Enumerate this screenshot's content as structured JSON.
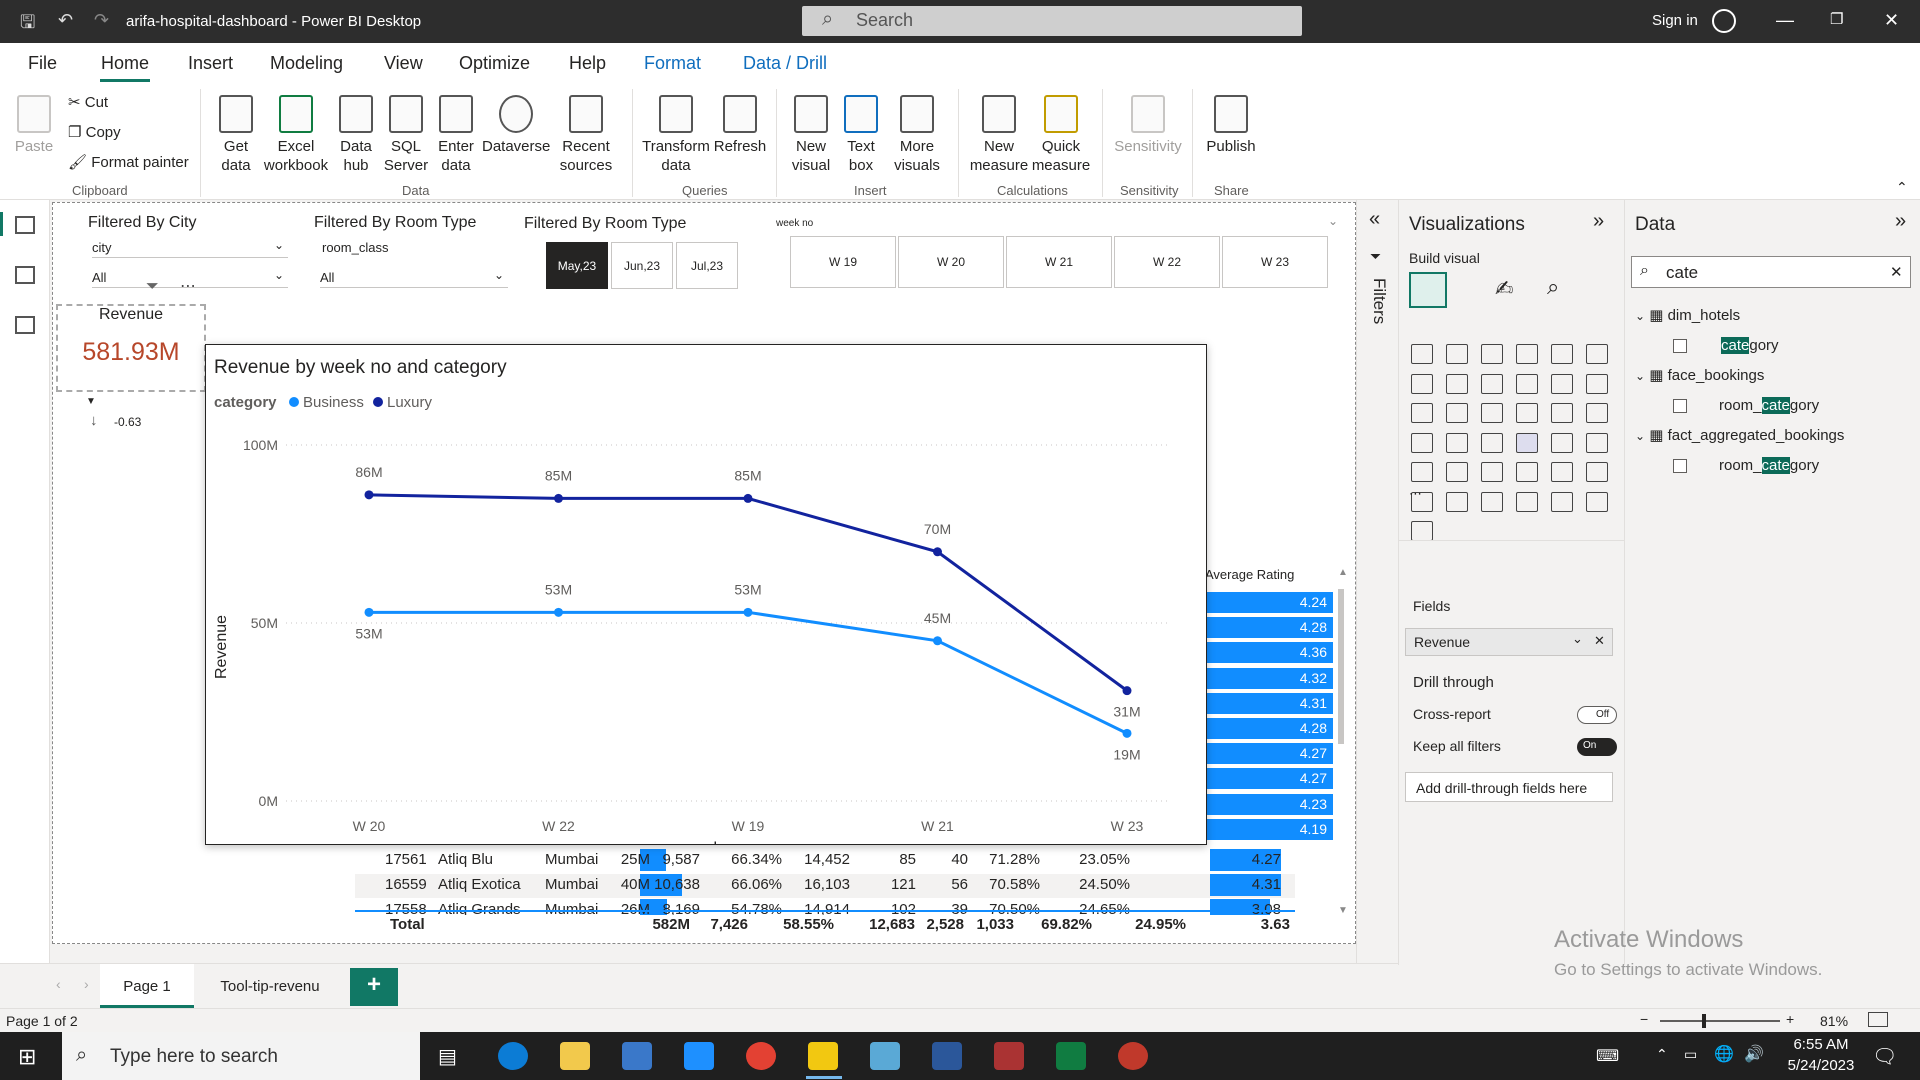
{
  "window": {
    "title": "arifa-hospital-dashboard - Power BI Desktop",
    "search_placeholder": "Search",
    "sign_in": "Sign in"
  },
  "tabs": [
    "File",
    "Home",
    "Insert",
    "Modeling",
    "View",
    "Optimize",
    "Help",
    "Format",
    "Data / Drill"
  ],
  "ribbon": {
    "clipboard": {
      "paste": "Paste",
      "cut": "Cut",
      "copy": "Copy",
      "format_painter": "Format painter",
      "label": "Clipboard"
    },
    "data": {
      "get_data": "Get data",
      "excel": "Excel workbook",
      "data_hub": "Data hub",
      "sql": "SQL Server",
      "enter": "Enter data",
      "dataverse": "Dataverse",
      "recent": "Recent sources",
      "label": "Data"
    },
    "queries": {
      "transform": "Transform data",
      "refresh": "Refresh",
      "label": "Queries"
    },
    "insert": {
      "new_visual": "New visual",
      "text_box": "Text box",
      "more_visuals": "More visuals",
      "label": "Insert"
    },
    "calculations": {
      "new_measure": "New measure",
      "quick_measure": "Quick measure",
      "label": "Calculations"
    },
    "sensitivity": {
      "btn": "Sensitivity",
      "label": "Sensitivity"
    },
    "share": {
      "publish": "Publish",
      "label": "Share"
    }
  },
  "slicers": {
    "city": {
      "title": "Filtered By City",
      "field": "city",
      "value": "All"
    },
    "room_type": {
      "title": "Filtered By Room Type",
      "field": "room_class",
      "value": "All"
    },
    "month": {
      "title": "Filtered By Room Type",
      "tiles": [
        "May,23",
        "Jun,23",
        "Jul,23"
      ],
      "selected": "May,23"
    },
    "week": {
      "field": "week no",
      "tiles": [
        "W 19",
        "W 20",
        "W 21",
        "W 22",
        "W 23"
      ]
    }
  },
  "card": {
    "label": "Revenue",
    "value": "581.93M",
    "delta": "-0.63"
  },
  "chart_data": {
    "type": "line",
    "title": "Revenue by week no and category",
    "legend_title": "category",
    "xlabel": "week no",
    "ylabel": "Revenue",
    "categories": [
      "W 20",
      "W 22",
      "W 19",
      "W 21",
      "W 23"
    ],
    "y_ticks": [
      "100M",
      "50M",
      "0M"
    ],
    "ylim": [
      0,
      100
    ],
    "series": [
      {
        "name": "Business",
        "color": "#118dff",
        "values": [
          53,
          53,
          53,
          45,
          19
        ],
        "labels": [
          "53M",
          "53M",
          "53M",
          "45M",
          "19M"
        ]
      },
      {
        "name": "Luxury",
        "color": "#12239e",
        "values": [
          86,
          85,
          85,
          70,
          31
        ],
        "labels": [
          "86M",
          "85M",
          "85M",
          "70M",
          "31M"
        ]
      }
    ]
  },
  "table": {
    "header_avg_rating": "Average Rating",
    "rating_bars": [
      "4.24",
      "4.28",
      "4.36",
      "4.32",
      "4.31",
      "4.28",
      "4.27",
      "4.27",
      "4.23",
      "4.19"
    ],
    "rows": [
      [
        "17561",
        "Atliq Blu",
        "Mumbai",
        "25M",
        "9,587",
        "66.34%",
        "14,452",
        "85",
        "40",
        "71.28%",
        "23.05%",
        "4.27"
      ],
      [
        "16559",
        "Atliq Exotica",
        "Mumbai",
        "40M",
        "10,638",
        "66.06%",
        "16,103",
        "121",
        "56",
        "70.58%",
        "24.50%",
        "4.31"
      ],
      [
        "17558",
        "Atliq Grands",
        "Mumbai",
        "26M",
        "8,169",
        "54.78%",
        "14,914",
        "102",
        "39",
        "70.50%",
        "24.65%",
        "3.08"
      ]
    ],
    "total": [
      "Total",
      "582M",
      "7,426",
      "58.55%",
      "12,683",
      "2,528",
      "1,033",
      "69.82%",
      "24.95%",
      "3.63"
    ]
  },
  "filters_label": "Filters",
  "viz_pane": {
    "title": "Visualizations",
    "build": "Build visual",
    "fields": "Fields",
    "field_value": "Revenue",
    "drill": "Drill through",
    "cross_report": "Cross-report",
    "cross_state": "Off",
    "keep_filters": "Keep all filters",
    "keep_state": "On",
    "add_drill": "Add drill-through fields here"
  },
  "data_pane": {
    "title": "Data",
    "search": "cate",
    "tables": [
      {
        "name": "dim_hotels",
        "pre": "",
        "hl": "cate",
        "post": "gory"
      },
      {
        "name": "face_bookings",
        "pre": "room_",
        "hl": "cate",
        "post": "gory"
      },
      {
        "name": "fact_aggregated_bookings",
        "pre": "room_",
        "hl": "cate",
        "post": "gory"
      }
    ]
  },
  "pages": [
    "Page 1",
    "Tool-tip-revenu"
  ],
  "status": {
    "page": "Page 1 of 2",
    "zoom": "81%"
  },
  "activate": {
    "title": "Activate Windows",
    "sub": "Go to Settings to activate Windows."
  },
  "taskbar": {
    "search": "Type here to search",
    "time": "6:55 AM",
    "date": "5/24/2023"
  }
}
